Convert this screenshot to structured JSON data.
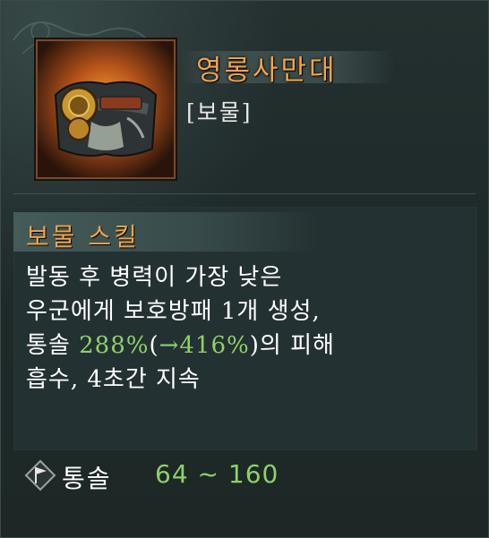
{
  "item": {
    "name": "영롱사만대",
    "type": "[보물]",
    "icon": "treasure-belt-icon"
  },
  "skill": {
    "label": "보물 스킬",
    "line1": "발동 후 병력이 가장 낮은",
    "line2": "우군에게 보호방패 1개 생성,",
    "line3_pre": "통솔 ",
    "line3_value": "288%",
    "line3_mid": "(",
    "line3_upgrade": "→416%",
    "line3_post": ")의 피해",
    "line4": "흡수, 4초간 지속"
  },
  "stat": {
    "icon": "command-flag-icon",
    "name": "통솔",
    "range": "64 ~ 160"
  },
  "colors": {
    "title": "#f0a44c",
    "highlight": "#8fd06a",
    "text": "#ffffff"
  }
}
